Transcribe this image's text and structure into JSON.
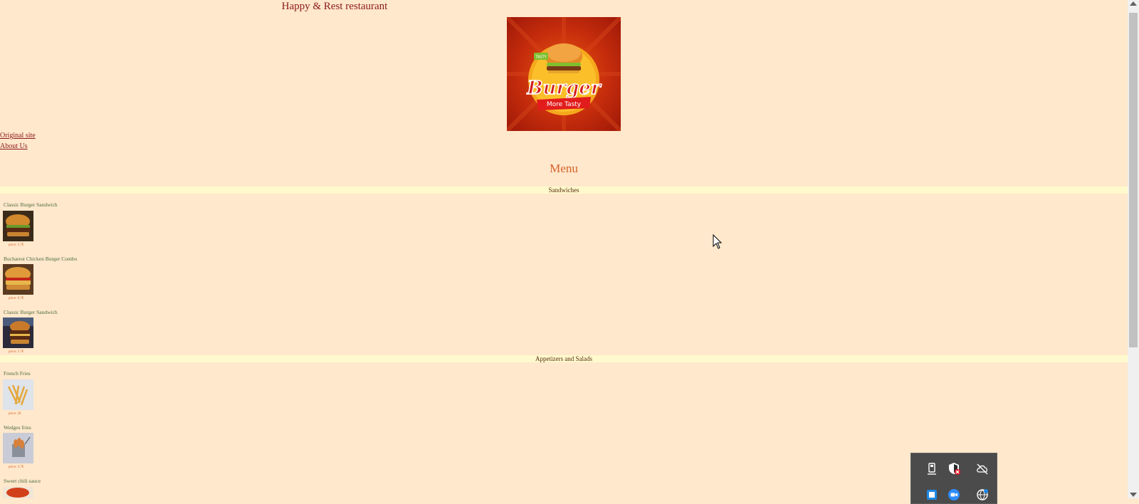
{
  "header": {
    "title": "Happy & Rest restaurant",
    "logo": {
      "brand": "Burger",
      "tagline": "More Tasty",
      "badge": "TASTY",
      "icon": "burger-logo"
    }
  },
  "nav": {
    "original_site": "Original site",
    "about_us": "About Us"
  },
  "menu": {
    "title": "Menu",
    "categories": [
      {
        "name": "Sandwiches",
        "items": [
          {
            "name": "Classic Burger Sandwich",
            "price": "price: 5.7€",
            "icon": "burger-photo"
          },
          {
            "name": "Bucharest Chicken Burger Combo",
            "price": "price: 6.7€",
            "icon": "chicken-burger-photo"
          },
          {
            "name": "Classic Burger Sandwich",
            "price": "price: 5.7€",
            "icon": "double-burger-photo"
          }
        ]
      },
      {
        "name": "Appetizers and Salads",
        "items": [
          {
            "name": "French Fries",
            "price": "price: 2€",
            "icon": "fries-photo"
          },
          {
            "name": "Wedges fries",
            "price": "price: 3.7€",
            "icon": "wedges-photo"
          },
          {
            "name": "Sweet chili sauce",
            "price": "",
            "icon": "sauce-photo"
          }
        ]
      }
    ]
  },
  "colors": {
    "background": "#ffe8cc",
    "category_bar": "#fffacd",
    "title_text": "#8b1a1a",
    "menu_heading": "#d4622a",
    "item_name": "#4a6a3a",
    "price_text": "#d4622a"
  },
  "system_tray": {
    "icons": [
      "usb-eject-icon",
      "security-warning-icon",
      "cloud-offline-icon",
      "app-icon",
      "zoom-icon",
      "network-icon"
    ]
  }
}
